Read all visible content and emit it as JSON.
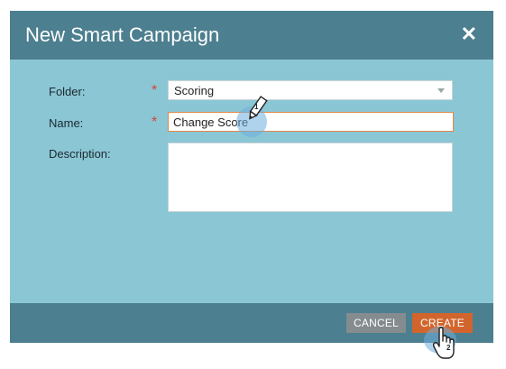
{
  "dialog": {
    "title": "New Smart Campaign",
    "close_icon": "✕"
  },
  "form": {
    "folder": {
      "label": "Folder:",
      "required_mark": "*",
      "value": "Scoring"
    },
    "name": {
      "label": "Name:",
      "required_mark": "*",
      "value": "Change Score"
    },
    "description": {
      "label": "Description:",
      "value": ""
    }
  },
  "footer": {
    "cancel_label": "CANCEL",
    "create_label": "CREATE"
  },
  "annotations": {
    "step1": "1",
    "step2": "2"
  },
  "icons": {
    "close": "close-icon",
    "dropdown": "chevron-down-icon",
    "pencil": "pencil-cursor-icon",
    "hand": "hand-pointer-icon"
  },
  "colors": {
    "header": "#4c7f8f",
    "body": "#8bc6d4",
    "required": "#d2463a",
    "create_button": "#d2652d",
    "cancel_button": "#848c8f",
    "focus_border": "#e0894a"
  }
}
